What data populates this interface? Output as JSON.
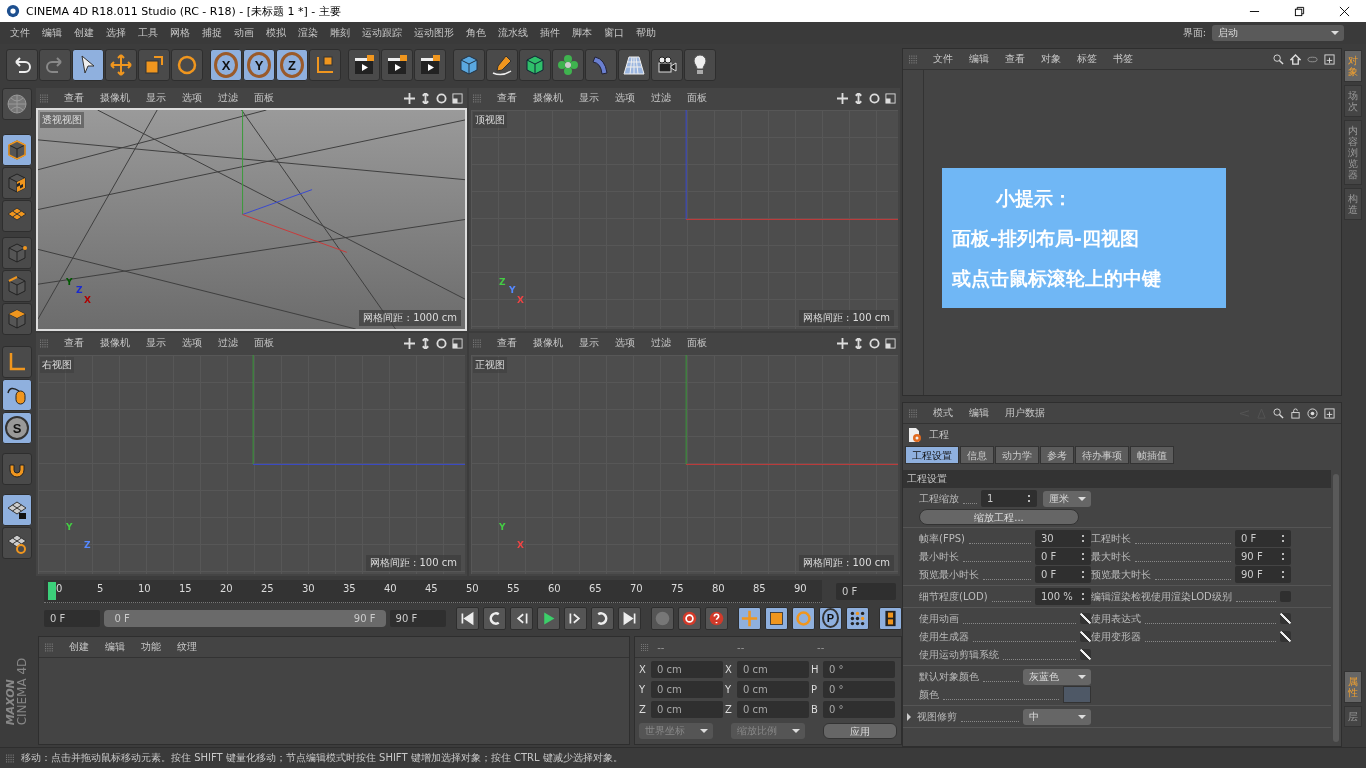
{
  "window": {
    "title": "CINEMA 4D R18.011 Studio (RC - R18) - [未标题 1 *] - 主要"
  },
  "menu_bar": {
    "items": [
      "文件",
      "编辑",
      "创建",
      "选择",
      "工具",
      "网格",
      "捕捉",
      "动画",
      "模拟",
      "渲染",
      "雕刻",
      "运动跟踪",
      "运动图形",
      "角色",
      "流水线",
      "插件",
      "脚本",
      "窗口",
      "帮助"
    ],
    "layout_label": "界面:",
    "layout_value": "启动"
  },
  "toolbar": [
    {
      "kind": "undo",
      "selected": false
    },
    {
      "kind": "redo",
      "selected": false
    },
    {
      "kind": "select",
      "selected": true
    },
    {
      "kind": "move",
      "selected": false
    },
    {
      "kind": "scale",
      "selected": false
    },
    {
      "kind": "rotate",
      "selected": false
    },
    {
      "kind": "axis",
      "label": "X",
      "selected": true
    },
    {
      "kind": "axis",
      "label": "Y",
      "selected": true
    },
    {
      "kind": "axis",
      "label": "Z",
      "selected": true
    },
    {
      "kind": "coords",
      "selected": false
    },
    {
      "kind": "clapper",
      "selected": false
    },
    {
      "kind": "clapper",
      "selected": false
    },
    {
      "kind": "clapper",
      "selected": false
    },
    {
      "kind": "cube",
      "selected": false
    },
    {
      "kind": "pen",
      "selected": false
    },
    {
      "kind": "framed-cube",
      "selected": false
    },
    {
      "kind": "flower",
      "selected": false
    },
    {
      "kind": "bend",
      "selected": false
    },
    {
      "kind": "floor",
      "selected": false
    },
    {
      "kind": "camera",
      "selected": false
    },
    {
      "kind": "bulb",
      "selected": false
    }
  ],
  "tool_strip": [
    {
      "kind": "globe",
      "selected": false
    },
    {
      "kind": "cube",
      "selected": true
    },
    {
      "kind": "texture",
      "selected": false
    },
    {
      "kind": "grid",
      "selected": false
    },
    {
      "kind": "points",
      "selected": false
    },
    {
      "kind": "edges",
      "selected": false
    },
    {
      "kind": "polygons",
      "selected": false
    },
    {
      "kind": "axis",
      "selected": false
    },
    {
      "kind": "mouse",
      "selected": true
    },
    {
      "kind": "letter",
      "label": "S",
      "selected": true
    },
    {
      "kind": "magnet",
      "selected": false
    },
    {
      "kind": "lock-grid",
      "selected": true
    },
    {
      "kind": "grid-ring",
      "selected": false
    }
  ],
  "viewports": [
    {
      "kind": "perspective",
      "label": "透视视图",
      "selected": true,
      "menus": [
        "查看",
        "摄像机",
        "显示",
        "选项",
        "过滤",
        "面板"
      ],
      "grid_spacing": "网格间距 : 1000 cm",
      "gizmo": [
        "Y",
        "Z",
        "X"
      ]
    },
    {
      "kind": "top",
      "label": "顶视图",
      "selected": false,
      "menus": [
        "查看",
        "摄像机",
        "显示",
        "选项",
        "过滤",
        "面板"
      ],
      "grid_spacing": "网格间距 : 100 cm",
      "gizmo": [
        "Z",
        "Y",
        "X"
      ]
    },
    {
      "kind": "right",
      "label": "右视图",
      "selected": false,
      "menus": [
        "查看",
        "摄像机",
        "显示",
        "选项",
        "过滤",
        "面板"
      ],
      "grid_spacing": "网格间距 : 100 cm",
      "gizmo": [
        "Y",
        "Z"
      ]
    },
    {
      "kind": "front",
      "label": "正视图",
      "selected": false,
      "menus": [
        "查看",
        "摄像机",
        "显示",
        "选项",
        "过滤",
        "面板"
      ],
      "grid_spacing": "网格间距 : 100 cm",
      "gizmo": [
        "Y",
        "X"
      ]
    }
  ],
  "timeline": {
    "ticks": [
      "0",
      "5",
      "10",
      "15",
      "20",
      "25",
      "30",
      "35",
      "40",
      "45",
      "50",
      "55",
      "60",
      "65",
      "70",
      "75",
      "80",
      "85",
      "90"
    ],
    "level": 0,
    "current": "0 F"
  },
  "transport": {
    "level": 1,
    "start": "0 F",
    "range_start": "0 F",
    "range_end": "90 F",
    "end": "90 F",
    "buttons": [
      {
        "kind": "go-start",
        "selected": false
      },
      {
        "kind": "prev-key",
        "selected": false
      },
      {
        "kind": "prev-frame",
        "selected": false
      },
      {
        "kind": "play",
        "selected": false
      },
      {
        "kind": "next-frame",
        "selected": false
      },
      {
        "kind": "next-key",
        "selected": false
      },
      {
        "kind": "go-end",
        "selected": false
      },
      {
        "kind": "key-off",
        "selected": false
      },
      {
        "kind": "record",
        "selected": false
      },
      {
        "kind": "help",
        "selected": false
      },
      {
        "kind": "move",
        "selected": true
      },
      {
        "kind": "scale",
        "selected": true
      },
      {
        "kind": "rotate",
        "selected": true
      },
      {
        "kind": "letter",
        "label": "P",
        "selected": true
      },
      {
        "kind": "dots",
        "selected": true
      },
      {
        "kind": "film",
        "selected": true
      }
    ]
  },
  "materials": {
    "menus": [
      "创建",
      "编辑",
      "功能",
      "纹理"
    ],
    "logo_brand": "MAXON",
    "logo_product": "CINEMA 4D"
  },
  "coordinates": {
    "headers": [
      "--",
      "--",
      "--"
    ],
    "rows": [
      [
        {
          "label": "X",
          "value": "0 cm"
        },
        {
          "label": "X",
          "value": "0 cm"
        },
        {
          "label": "H",
          "value": "0 °"
        }
      ],
      [
        {
          "label": "Y",
          "value": "0 cm"
        },
        {
          "label": "Y",
          "value": "0 cm"
        },
        {
          "label": "P",
          "value": "0 °"
        }
      ],
      [
        {
          "label": "Z",
          "value": "0 cm"
        },
        {
          "label": "Z",
          "value": "0 cm"
        },
        {
          "label": "B",
          "value": "0 °"
        }
      ]
    ],
    "dropdowns": [
      "世界坐标",
      "缩放比例"
    ],
    "apply": "应用"
  },
  "object_manager": {
    "menus": [
      "文件",
      "编辑",
      "查看",
      "对象",
      "标签",
      "书签"
    ],
    "tip": {
      "title": "小提示：",
      "lines": [
        "面板-排列布局-四视图",
        "或点击鼠标滚轮上的中键"
      ]
    }
  },
  "attributes": {
    "menus": [
      "模式",
      "编辑",
      "用户数据"
    ],
    "object": "工程",
    "tabs": [
      {
        "label": "工程设置",
        "selected": true
      },
      {
        "label": "信息",
        "selected": false
      },
      {
        "label": "动力学",
        "selected": false
      },
      {
        "label": "参考",
        "selected": false
      },
      {
        "label": "待办事项",
        "selected": false
      },
      {
        "label": "帧插值",
        "selected": false
      }
    ],
    "section": "工程设置",
    "groups": [
      {
        "rows": [
          [
            {
              "kind": "spin",
              "label": "工程缩放",
              "value": "1",
              "unit": "厘米"
            }
          ],
          [
            {
              "kind": "button",
              "label": "缩放工程..."
            }
          ]
        ]
      },
      {
        "rows": [
          [
            {
              "kind": "spin",
              "label": "帧率(FPS)",
              "value": "30"
            },
            {
              "kind": "spin",
              "label": "工程时长",
              "value": "0 F"
            }
          ],
          [
            {
              "kind": "spin",
              "label": "最小时长",
              "value": "0 F"
            },
            {
              "kind": "spin",
              "label": "最大时长",
              "value": "90 F"
            }
          ],
          [
            {
              "kind": "spin",
              "label": "预览最小时长",
              "value": "0 F"
            },
            {
              "kind": "spin",
              "label": "预览最大时长",
              "value": "90 F"
            }
          ]
        ]
      },
      {
        "rows": [
          [
            {
              "kind": "spin",
              "label": "细节程度(LOD)",
              "value": "100 %"
            },
            {
              "kind": "check",
              "label": "编辑渲染检视使用渲染LOD级别",
              "checked": false
            }
          ]
        ]
      },
      {
        "rows": [
          [
            {
              "kind": "check",
              "label": "使用动画",
              "checked": true
            },
            {
              "kind": "check",
              "label": "使用表达式",
              "checked": true
            }
          ],
          [
            {
              "kind": "check",
              "label": "使用生成器",
              "checked": true
            },
            {
              "kind": "check",
              "label": "使用变形器",
              "checked": true
            }
          ],
          [
            {
              "kind": "check",
              "label": "使用运动剪辑系统",
              "checked": true
            }
          ]
        ]
      },
      {
        "rows": [
          [
            {
              "kind": "dropdown",
              "label": "默认对象颜色",
              "value": "灰蓝色"
            }
          ],
          [
            {
              "kind": "color",
              "label": "颜色",
              "color": "#4e5866"
            }
          ]
        ]
      },
      {
        "rows": [
          [
            {
              "kind": "dropdown",
              "label": "视图修剪",
              "value": "中",
              "expandable": true
            }
          ]
        ]
      }
    ]
  },
  "side_tabs": {
    "top": [
      {
        "label": "对象",
        "selected": true
      },
      {
        "label": "场次",
        "selected": false
      },
      {
        "label": "内容浏览器",
        "selected": false
      },
      {
        "label": "构造",
        "selected": false
      }
    ],
    "bottom": [
      {
        "label": "属性",
        "selected": true
      },
      {
        "label": "层",
        "selected": false
      }
    ]
  },
  "status_bar": {
    "text": "移动：点击并拖动鼠标移动元素。按住 SHIFT 键量化移动；节点编辑模式时按住 SHIFT 键增加选择对象；按住 CTRL 键减少选择对象。"
  }
}
